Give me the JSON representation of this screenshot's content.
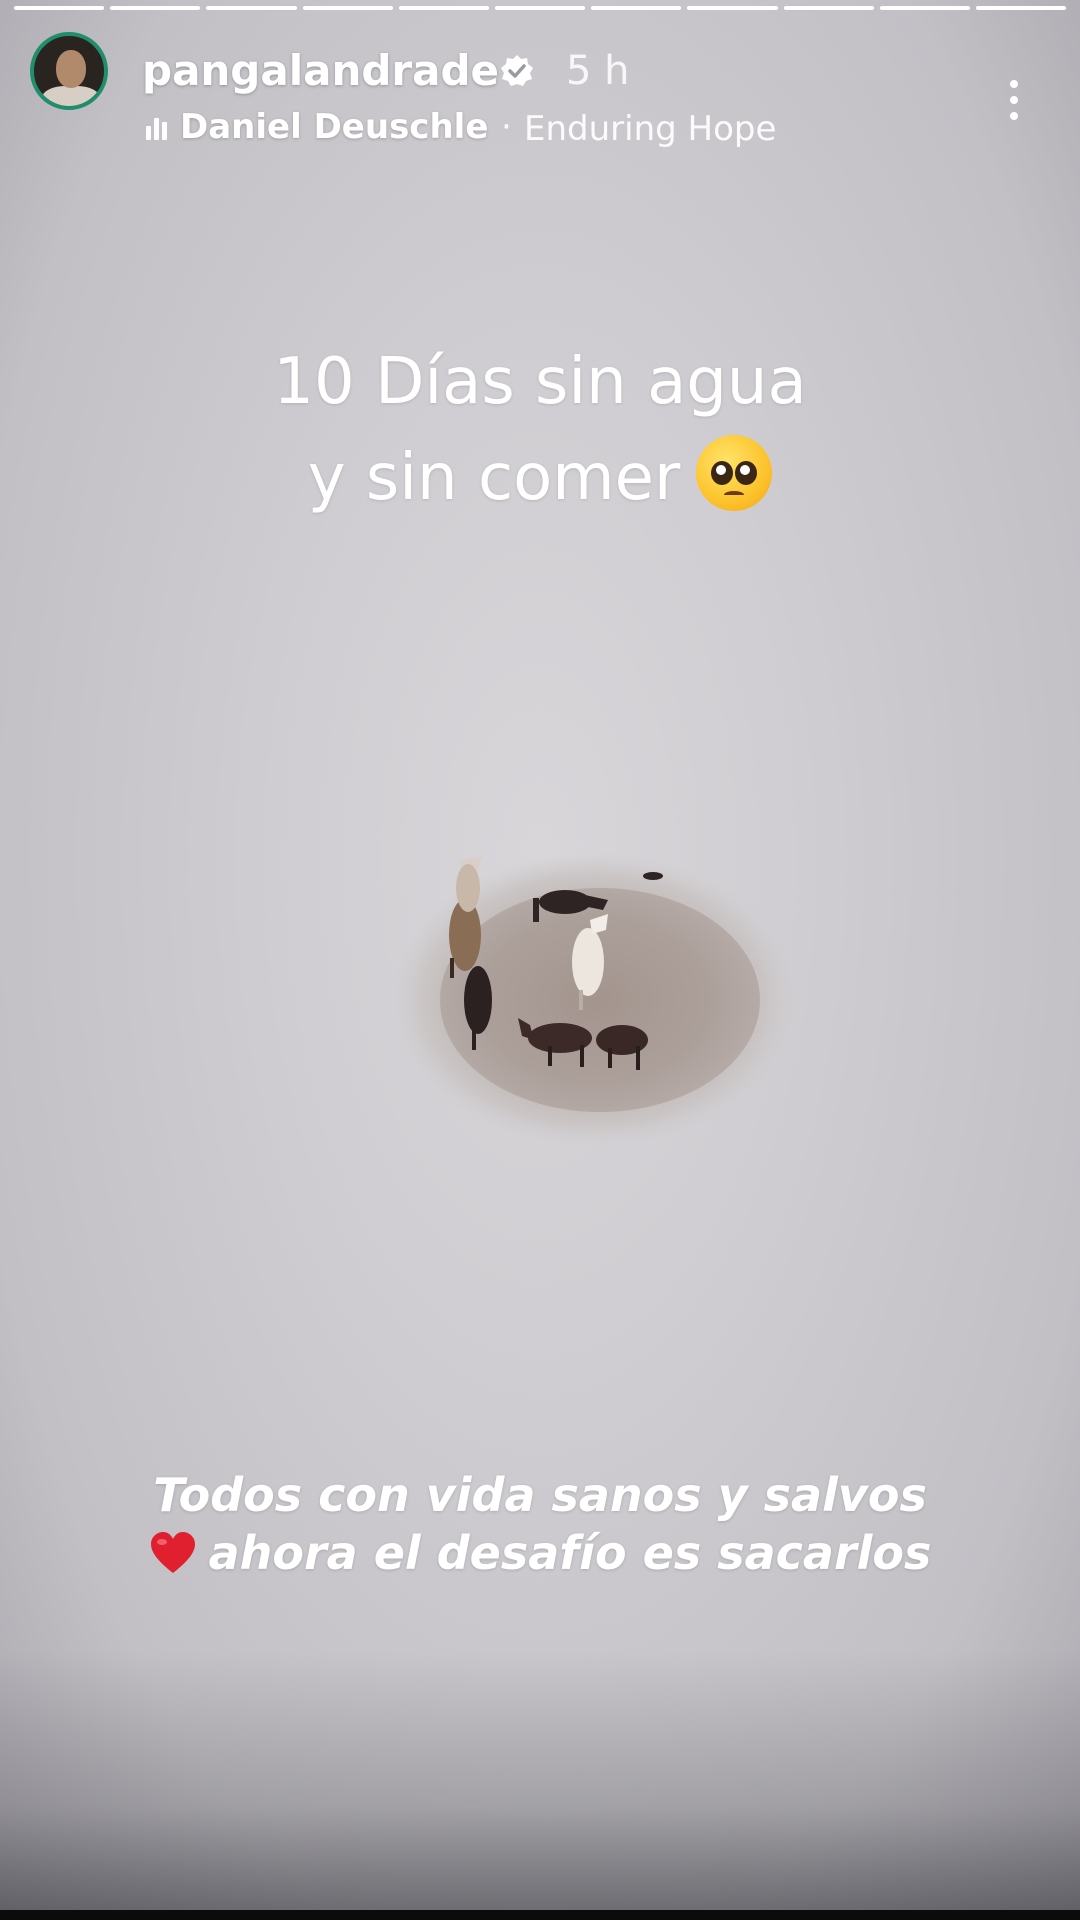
{
  "story": {
    "progress_segments": [
      1,
      1,
      1,
      1,
      1,
      1,
      1,
      1,
      1,
      1,
      1
    ],
    "colors": {
      "ring": "#1f8f6b",
      "heart": "#e0202f",
      "emoji": "#fcc32c"
    }
  },
  "header": {
    "username": "pangalandrade",
    "time_ago": "5 h",
    "music": {
      "artist": "Daniel Deuschle",
      "separator": "·",
      "title": "Enduring Hope"
    }
  },
  "overlay": {
    "headline_line1": "10 Días sin agua",
    "headline_line2": "y sin comer",
    "headline_emoji": "pleading-face-emoji",
    "caption_line1": "Todos con vida sanos y salvos",
    "caption_line2": "ahora el desafío es sacarlos",
    "caption_emoji": "red-heart-emoji"
  }
}
